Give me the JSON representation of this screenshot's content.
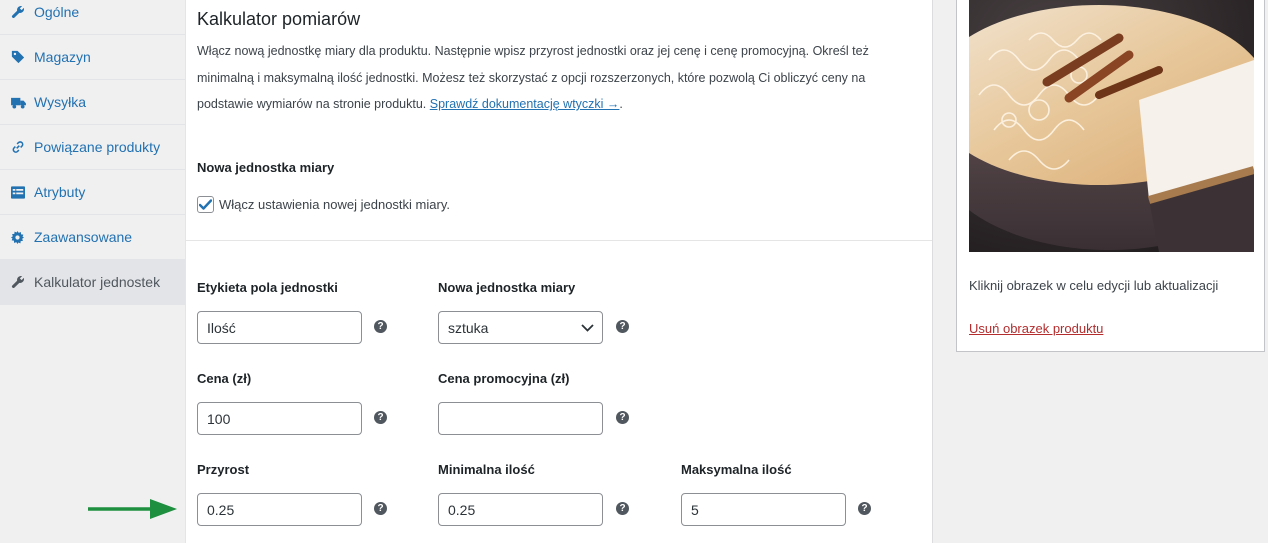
{
  "tabs": [
    {
      "label": "Ogólne",
      "icon": "wrench-icon"
    },
    {
      "label": "Magazyn",
      "icon": "tag-icon"
    },
    {
      "label": "Wysyłka",
      "icon": "truck-icon"
    },
    {
      "label": "Powiązane produkty",
      "icon": "link-icon"
    },
    {
      "label": "Atrybuty",
      "icon": "list-icon"
    },
    {
      "label": "Zaawansowane",
      "icon": "gear-icon"
    },
    {
      "label": "Kalkulator jednostek",
      "icon": "wrench-icon",
      "active": true
    }
  ],
  "section": {
    "title": "Kalkulator pomiarów",
    "description_line1": "Włącz nową jednostkę miary dla produktu. Następnie wpisz przyrost jednostki oraz jej cenę i cenę promocyjną. Określ też",
    "description_line2": "minimalną i maksymalną ilość jednostki. Możesz też skorzystać z opcji rozszerzonych, które pozwolą Ci obliczyć ceny na",
    "description_line3_prefix": "podstawie wymiarów na stronie produktu. ",
    "doc_link": "Sprawdź dokumentację wtyczki →",
    "description_suffix": ".",
    "subheading": "Nowa jednostka miary",
    "checkbox_label": "Włącz ustawienia nowej jednostki miary.",
    "checkbox_checked": true
  },
  "fields": {
    "unit_label": {
      "label": "Etykieta pola jednostki",
      "value": "Ilość"
    },
    "new_unit": {
      "label": "Nowa jednostka miary",
      "value": "sztuka"
    },
    "price": {
      "label": "Cena (zł)",
      "value": "100"
    },
    "sale_price": {
      "label": "Cena promocyjna (zł)",
      "value": ""
    },
    "increment": {
      "label": "Przyrost",
      "value": "0.25"
    },
    "min_qty": {
      "label": "Minimalna ilość",
      "value": "0.25"
    },
    "max_qty": {
      "label": "Maksymalna ilość",
      "value": "5"
    }
  },
  "help_icon": "?",
  "product_image": {
    "note": "Kliknij obrazek w celu edycji lub aktualizacji",
    "remove_link": "Usuń obrazek produktu"
  },
  "colors": {
    "link": "#2271b1",
    "remove_link": "#b32d2e",
    "arrow": "#1e8f3e",
    "checkmark": "#2271b1"
  }
}
